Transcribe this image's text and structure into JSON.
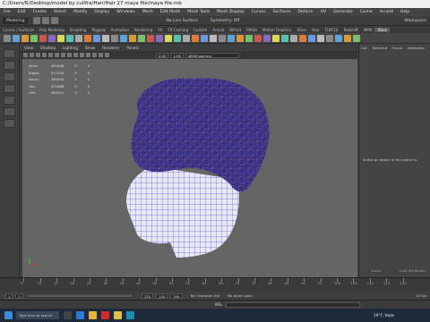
{
  "window": {
    "title": "C:/Users/R/Desktop/model by cullfra/Hair/Hair 27 maya file/maya file.mb"
  },
  "menu": [
    "File",
    "Edit",
    "Create",
    "Select",
    "Modify",
    "Display",
    "Windows",
    "Mesh",
    "Edit Mesh",
    "Mesh Tools",
    "Mesh Display",
    "Curves",
    "Surfaces",
    "Deform",
    "UV",
    "Generate",
    "Cache",
    "Arnold",
    "Help"
  ],
  "statusline": {
    "mode": "Modeling",
    "live_surface": "No Live Surface",
    "symmetry": "Symmetry: Off",
    "workspace": "Workspace"
  },
  "shelf_tabs": [
    "Curves / Surfaces",
    "Poly Modeling",
    "Sculpting",
    "Rigging",
    "Animation",
    "Rendering",
    "FX",
    "FX Caching",
    "Custom",
    "Arnold",
    "Bifrost",
    "MASH",
    "Motion Graphics",
    "XGen",
    "Hair",
    "TURTLE",
    "Redshift",
    "MMA",
    "XGen"
  ],
  "shelf_active": "XGen",
  "panel_menu": [
    "View",
    "Shading",
    "Lighting",
    "Show",
    "Renderer",
    "Panels"
  ],
  "toolbar": {
    "value_a": "0.00",
    "value_b": "1.00",
    "colorspace": "sRGB gamma"
  },
  "hud": {
    "rows": [
      {
        "label": "Verts:",
        "v1": "491898",
        "v2": "0",
        "v3": "0"
      },
      {
        "label": "Edges:",
        "v1": "977245",
        "v2": "0",
        "v3": "0"
      },
      {
        "label": "Faces:",
        "v1": "485934",
        "v2": "0",
        "v3": "0"
      },
      {
        "label": "Tris:",
        "v1": "971868",
        "v2": "0",
        "v3": "0"
      },
      {
        "label": "UVs:",
        "v1": "484591",
        "v2": "0",
        "v3": "0"
      }
    ]
  },
  "right_panel": {
    "tabs": [
      "List",
      "Selected",
      "Focus",
      "Attributes",
      "Display"
    ],
    "message": "Select an object in the scene to",
    "buttons": [
      "Select",
      "Load Attributes"
    ]
  },
  "timeline": {
    "ticks": [
      "5",
      "10",
      "15",
      "20",
      "25",
      "30",
      "35",
      "40",
      "45",
      "50",
      "55",
      "60",
      "65",
      "70",
      "75",
      "80",
      "85",
      "90",
      "95",
      "100",
      "105",
      "110",
      "115",
      "120"
    ]
  },
  "range": {
    "start": "1",
    "start2": "1",
    "end": "120",
    "end2": "120",
    "end3": "200",
    "anim_layer": "No Anim Layer",
    "char_set": "No Character Set",
    "fps": "24 fps"
  },
  "mel": {
    "label": "MEL"
  },
  "taskbar": {
    "search": "Type here to search",
    "weather": "19°C",
    "location": "Haze",
    "colors": {
      "maya": "#1a8fb4",
      "chrome": "#e8b440",
      "edge": "#2b7bd6",
      "opera": "#d12b2b"
    }
  },
  "viewport": {
    "bg": "#656565",
    "wire": "#2b2ad0",
    "skin": "#e8e8f5"
  }
}
